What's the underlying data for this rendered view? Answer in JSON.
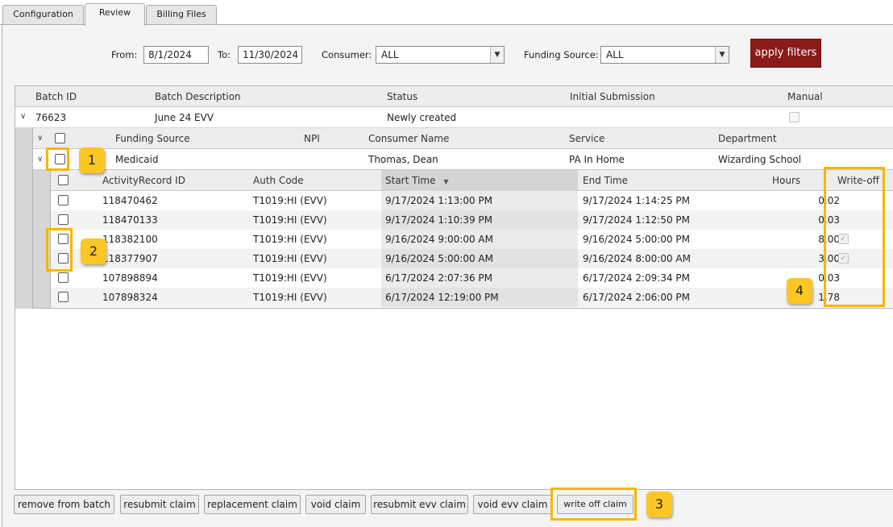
{
  "tabs": [
    "Configuration",
    "Review",
    "Billing Files"
  ],
  "filters": {
    "from_label": "From:",
    "from_value": "8/1/2024",
    "to_label": "To:",
    "to_value": "11/30/2024",
    "consumer_label": "Consumer:",
    "consumer_value": "ALL",
    "funding_label": "Funding Source:",
    "funding_value": "ALL",
    "apply_label": "apply filters"
  },
  "batch_columns": [
    "Batch ID",
    "Batch Description",
    "Status",
    "Initial Submission",
    "Manual"
  ],
  "batch": {
    "id": "76623",
    "description": "June 24 EVV",
    "status": "Newly created",
    "initial_submission": ""
  },
  "funding_columns": [
    "Funding Source",
    "NPI",
    "Consumer Name",
    "Service",
    "Department"
  ],
  "funding": {
    "source": "Medicaid",
    "npi": "",
    "consumer": "Thomas, Dean",
    "service": "PA In Home",
    "department": "Wizarding School"
  },
  "activity_columns": [
    "ActivityRecord ID",
    "Auth Code",
    "Start Time",
    "End Time",
    "Hours",
    "Write-off"
  ],
  "activities": [
    {
      "id": "118470462",
      "auth": "T1019:HI (EVV)",
      "start": "9/17/2024 1:13:00 PM",
      "end": "9/17/2024 1:14:25 PM",
      "hours": "0.02",
      "writeoff": false
    },
    {
      "id": "118470133",
      "auth": "T1019:HI (EVV)",
      "start": "9/17/2024 1:10:39 PM",
      "end": "9/17/2024 1:12:50 PM",
      "hours": "0.03",
      "writeoff": false
    },
    {
      "id": "118382100",
      "auth": "T1019:HI (EVV)",
      "start": "9/16/2024 9:00:00 AM",
      "end": "9/16/2024 5:00:00 PM",
      "hours": "8.00",
      "writeoff": true
    },
    {
      "id": "118377907",
      "auth": "T1019:HI (EVV)",
      "start": "9/16/2024 5:00:00 AM",
      "end": "9/16/2024 8:00:00 AM",
      "hours": "3.00",
      "writeoff": true
    },
    {
      "id": "107898894",
      "auth": "T1019:HI (EVV)",
      "start": "6/17/2024 2:07:36 PM",
      "end": "6/17/2024 2:09:34 PM",
      "hours": "0.03",
      "writeoff": false
    },
    {
      "id": "107898324",
      "auth": "T1019:HI (EVV)",
      "start": "6/17/2024 12:19:00 PM",
      "end": "6/17/2024 2:06:00 PM",
      "hours": "1.78",
      "writeoff": false
    }
  ],
  "actions": [
    "remove from batch",
    "resubmit claim",
    "replacement claim",
    "void claim",
    "resubmit evv claim",
    "void evv claim",
    "write off claim"
  ],
  "callouts": [
    "1",
    "2",
    "3",
    "4"
  ],
  "colors": {
    "apply_button": "#8b1a1a",
    "callout": "#fcc623",
    "highlight": "#f5b700"
  }
}
